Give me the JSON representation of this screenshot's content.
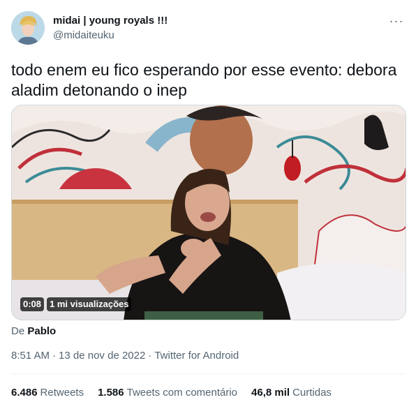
{
  "author": {
    "display_name": "midai | young royals !!!",
    "handle": "@midaiteuku",
    "avatar_icon": "avatar-icon"
  },
  "more_label": "···",
  "tweet_text": "todo enem eu fico esperando por esse evento: debora aladim detonando o inep",
  "media": {
    "duration": "0:08",
    "views": "1 mi visualizações"
  },
  "attribution": {
    "prefix": "De",
    "source": "Pablo"
  },
  "meta": {
    "time": "8:51 AM",
    "separator": "·",
    "date": "13 de nov de 2022",
    "client": "Twitter for Android"
  },
  "stats": [
    {
      "value": "6.486",
      "label": "Retweets"
    },
    {
      "value": "1.586",
      "label": "Tweets com comentário"
    },
    {
      "value": "46,8 mil",
      "label": "Curtidas"
    }
  ],
  "colors": {
    "text_primary": "#0f1419",
    "text_secondary": "#536471",
    "border": "#cfd9de"
  }
}
